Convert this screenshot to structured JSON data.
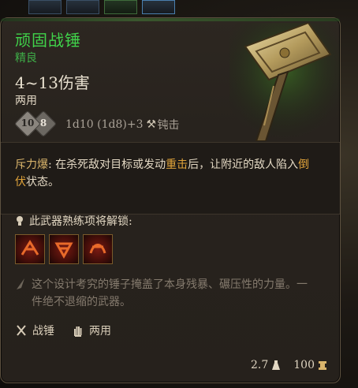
{
  "item": {
    "name": "顽固战锤",
    "rarity": "精良",
    "damage": "4~13伤害",
    "handedness": "两用",
    "dice": {
      "left": "10",
      "right": "8"
    },
    "damage_formula": "1d10 (1d8)+3",
    "damage_type": "钝击"
  },
  "passive": {
    "title": "斥力爆",
    "text_before": ": 在杀死敌对目标或发动",
    "keyword1": "重击",
    "text_mid": "后，让附近的敌人陷入",
    "keyword2": "倒伏",
    "text_after": "状态。"
  },
  "unlock": {
    "label": "此武器熟练项将解锁:"
  },
  "flavor": "这个设计考究的锤子掩盖了本身残暴、碾压性的力量。一件绝不退缩的武器。",
  "properties": [
    {
      "icon": "warhammer-icon",
      "label": "战锤"
    },
    {
      "icon": "hand-icon",
      "label": "两用"
    }
  ],
  "footer": {
    "weight": "2.7",
    "price": "100"
  },
  "colors": {
    "name": "#40d24a",
    "rarity": "#3fae48",
    "keyword": "#e0a33a"
  }
}
